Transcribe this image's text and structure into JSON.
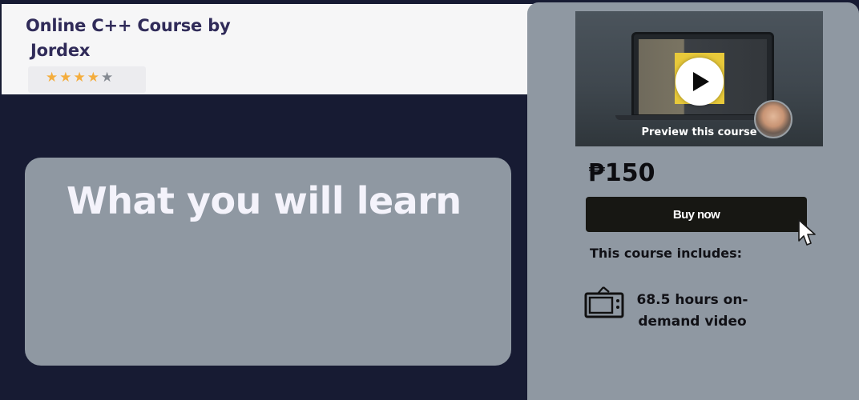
{
  "course": {
    "title_line1": "Online C++ Course by",
    "title_line2": "Jordex",
    "rating": {
      "filled_stars": 4,
      "total_stars": 5,
      "filled_star_char": "★",
      "empty_star_char": "★",
      "star_color": "#f4ad3d",
      "empty_star_color": "#858a92"
    }
  },
  "learn_section": {
    "heading": "What you will learn"
  },
  "sidebar": {
    "preview_label": "Preview this course",
    "price": "₱150",
    "buy_label": "Buy now",
    "includes_heading": "This course includes:",
    "includes": [
      {
        "icon": "tv-icon",
        "text": "68.5 hours on-demand video"
      }
    ]
  },
  "colors": {
    "page_background": "#171b33",
    "header_background": "#f6f6f7",
    "card_background": "#8f98a2",
    "title_color": "#302b59",
    "button_background": "#171713"
  }
}
